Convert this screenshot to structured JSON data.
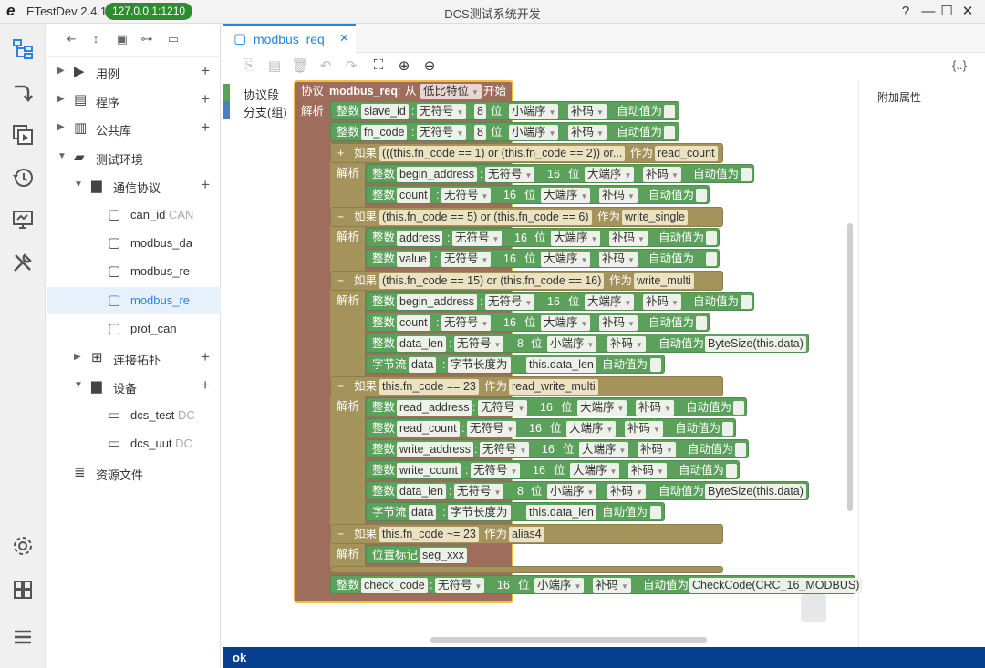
{
  "app": {
    "logo": "e",
    "name": "ETestDev 2.4.14",
    "address": "127.0.0.1:1210",
    "title": "DCS测试系统开发",
    "win_help": "?",
    "win_min": "—",
    "win_max": "☐",
    "win_close": "✕"
  },
  "tree": {
    "items": [
      {
        "label": "用例",
        "dim": ""
      },
      {
        "label": "程序",
        "dim": ""
      },
      {
        "label": "公共库",
        "dim": ""
      },
      {
        "label": "测试环境",
        "dim": ""
      },
      {
        "label": "通信协议",
        "dim": ""
      },
      {
        "label": "can_id",
        "dim": " CAN"
      },
      {
        "label": "modbus_da",
        "dim": ""
      },
      {
        "label": "modbus_re",
        "dim": ""
      },
      {
        "label": "modbus_re",
        "dim": ""
      },
      {
        "label": "prot_can",
        "dim": ""
      },
      {
        "label": "连接拓扑",
        "dim": ""
      },
      {
        "label": "设备",
        "dim": ""
      },
      {
        "label": "dcs_test",
        "dim": " DC"
      },
      {
        "label": "dcs_uut",
        "dim": " DC"
      },
      {
        "label": "资源文件",
        "dim": ""
      }
    ],
    "plus": "+"
  },
  "tab": {
    "label": "modbus_req",
    "close": "✕"
  },
  "toolbar": {
    "right": "{..}"
  },
  "categories": {
    "protocol": "协议段",
    "branch": "分支(组)"
  },
  "props": {
    "title": "附加属性"
  },
  "status": {
    "text": "ok"
  },
  "blocks": {
    "kw": {
      "protocol": "协议",
      "parse": "解析",
      "int": "整数",
      "if": "如果",
      "as": "作为",
      "bits": "位",
      "auto": "自动值为",
      "stream": "字节流",
      "lenis": "字节长度为",
      "marker": "位置标记",
      "from": "从",
      "start": "开始"
    },
    "proto_name": "modbus_req",
    "first_bit": "低比特位",
    "opt": {
      "unsigned": "无符号",
      "le": "小端序",
      "be": "大端序",
      "twos": "补码"
    },
    "top_fields": [
      {
        "name": "slave_id",
        "bits": "8"
      },
      {
        "name": "fn_code",
        "bits": "8"
      }
    ],
    "branches": [
      {
        "toggle": "+",
        "cond": "(((this.fn_code == 1) or (this.fn_code == 2)) or...",
        "as": "read_count"
      },
      {
        "toggle": "−",
        "cond": "(this.fn_code == 5) or (this.fn_code == 6)",
        "as": "write_single"
      },
      {
        "toggle": "−",
        "cond": "(this.fn_code == 15) or (this.fn_code == 16)",
        "as": "write_multi"
      },
      {
        "toggle": "−",
        "cond": "this.fn_code == 23",
        "as": "read_write_multi"
      },
      {
        "toggle": "−",
        "cond": "this.fn_code ~= 23",
        "as": "alias4"
      }
    ],
    "f": {
      "begin_address": "begin_address",
      "count": "count",
      "address": "address",
      "value": "value",
      "data_len": "data_len",
      "data": "data",
      "read_address": "read_address",
      "read_count": "read_count",
      "write_address": "write_address",
      "write_count": "write_count",
      "seg": "seg_xxx",
      "check_code": "check_code"
    },
    "n16": "16",
    "n8": "8",
    "bytesize": "ByteSize(this.data)",
    "datalen": "this.data_len",
    "checkfn": "CheckCode(CRC_16_MODBUS)"
  }
}
